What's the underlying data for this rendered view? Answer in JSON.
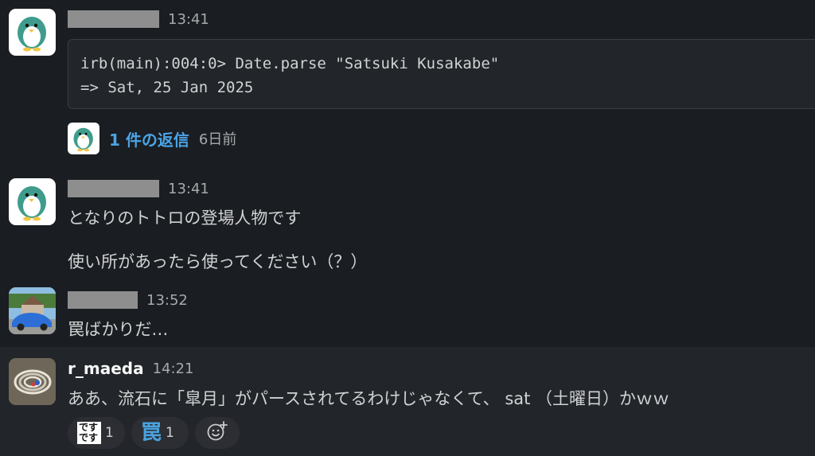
{
  "messages": [
    {
      "time": "13:41",
      "code_lines": [
        "irb(main):004:0> Date.parse \"Satsuki Kusakabe\"",
        "=> Sat, 25 Jan 2025"
      ],
      "thread": {
        "reply_label": "1 件の返信",
        "ago": "6日前"
      }
    },
    {
      "time": "13:41",
      "lines": [
        "となりのトトロの登場人物です",
        "使い所があったら使ってください（？）"
      ]
    },
    {
      "time": "13:52",
      "lines": [
        "罠ばかりだ…"
      ]
    },
    {
      "author": "r_maeda",
      "time": "14:21",
      "lines": [
        "ああ、流石に「皐月」がパースされてるわけじゃなくて、 sat （土曜日）かｗｗ"
      ],
      "reactions": [
        {
          "emoji_top": "です",
          "emoji_bottom": "です",
          "count": "1"
        },
        {
          "emoji": "罠",
          "count": "1"
        }
      ]
    }
  ],
  "icons": {
    "add_reaction": "add-reaction-icon",
    "avatar_penguin": "penguin-avatar",
    "avatar_car": "car-photo-avatar",
    "avatar_cables": "cables-photo-avatar"
  },
  "colors": {
    "background": "#1a1d21",
    "highlight": "#222529",
    "link": "#4ba3e5",
    "text": "#d1d2d3"
  }
}
